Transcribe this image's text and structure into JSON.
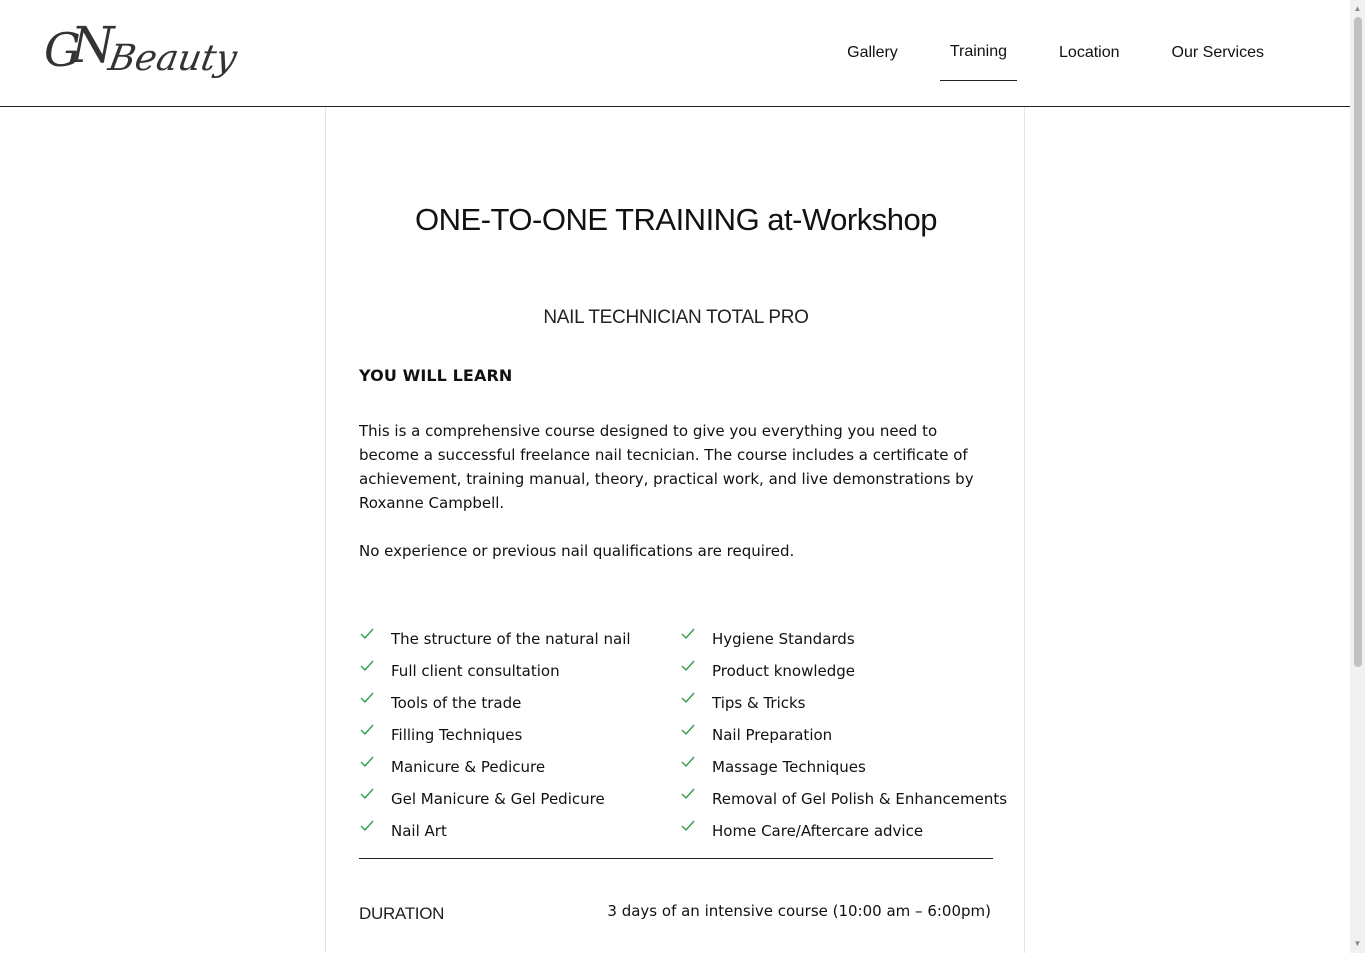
{
  "logo": {
    "text_part1": "G",
    "text_part2": "N",
    "text_part3": "Beauty"
  },
  "nav": {
    "items": [
      {
        "label": "Gallery"
      },
      {
        "label": "Training"
      },
      {
        "label": "Location"
      },
      {
        "label": "Our Services"
      }
    ],
    "active": "Training"
  },
  "content": {
    "title": "ONE-TO-ONE TRAINING  at-Workshop",
    "subtitle": "NAIL TECHNICIAN TOTAL PRO",
    "learn_heading": "YOU WILL LEARN",
    "description": "This is a comprehensive course designed to give you everything you need to become a successful freelance nail tecnician. The course includes a certificate of achievement, training manual, theory, practical work, and live demonstrations by Roxanne Campbell.",
    "no_experience": "No experience or previous nail qualifications are required.",
    "checklist_left": [
      "The structure of the natural nail",
      "Full client consultation",
      "Tools of the trade",
      "Filling Techniques",
      "Manicure & Pedicure",
      "Gel Manicure & Gel Pedicure",
      "Nail Art"
    ],
    "checklist_right": [
      "Hygiene Standards",
      "Product knowledge",
      "Tips & Tricks",
      "Nail Preparation",
      "Massage Techniques",
      "Removal of Gel Polish & Enhancements",
      "Home Care/Aftercare advice"
    ],
    "duration_label": "DURATION",
    "duration_value": "3 days of an intensive course (10:00 am – 6:00pm)"
  },
  "colors": {
    "check": "#2e9e4f",
    "text": "#111111",
    "divider": "#222222"
  }
}
